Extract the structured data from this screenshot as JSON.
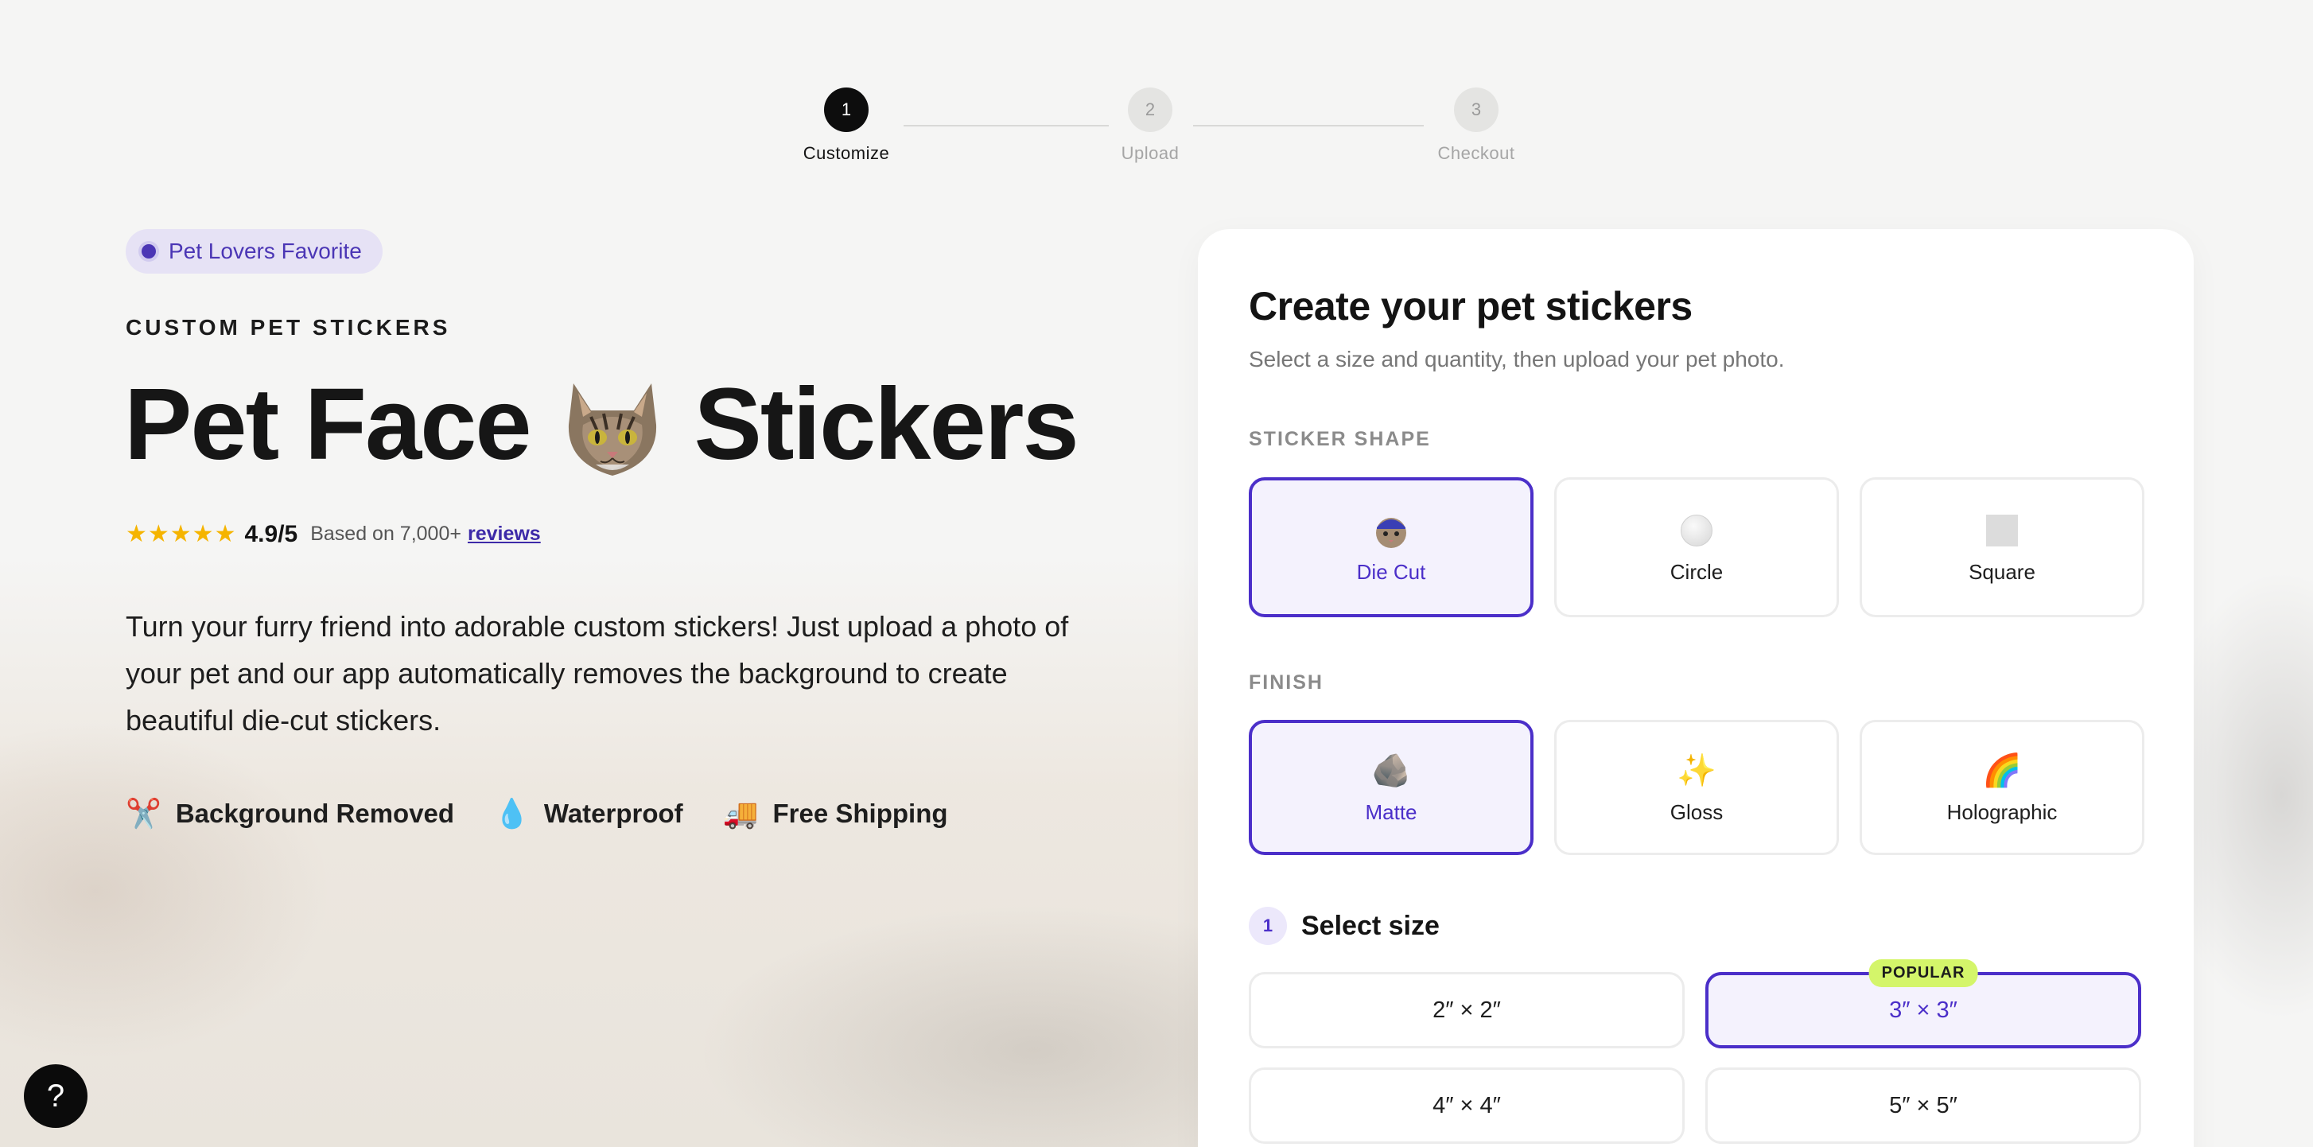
{
  "stepper": {
    "steps": [
      {
        "number": "1",
        "label": "Customize",
        "active": true
      },
      {
        "number": "2",
        "label": "Upload",
        "active": false
      },
      {
        "number": "3",
        "label": "Checkout",
        "active": false
      }
    ]
  },
  "hero": {
    "badge": "Pet Lovers Favorite",
    "eyebrow": "CUSTOM PET STICKERS",
    "title_part1": "Pet Face",
    "title_part2": "Stickers",
    "title_image": "cat-face-sticker",
    "rating": {
      "stars": "★★★★★",
      "value": "4.9/5",
      "text": "Based on 7,000+",
      "link": "reviews"
    },
    "description": "Turn your furry friend into adorable custom stickers! Just upload a photo of your pet and our app automatically removes the background to create beautiful die-cut stickers.",
    "features": [
      {
        "icon": "✂️",
        "icon_name": "scissors-icon",
        "label": "Background Removed"
      },
      {
        "icon": "💧",
        "icon_name": "droplet-icon",
        "label": "Waterproof"
      },
      {
        "icon": "🚚",
        "icon_name": "truck-icon",
        "label": "Free Shipping"
      }
    ]
  },
  "help": {
    "label": "?"
  },
  "card": {
    "title": "Create your pet stickers",
    "subtitle": "Select a size and quantity, then upload your pet photo.",
    "shape": {
      "label": "STICKER SHAPE",
      "options": [
        {
          "label": "Die Cut",
          "icon": "die-cut-icon",
          "selected": true
        },
        {
          "label": "Circle",
          "icon": "circle-icon",
          "selected": false
        },
        {
          "label": "Square",
          "icon": "square-icon",
          "selected": false
        }
      ]
    },
    "finish": {
      "label": "FINISH",
      "options": [
        {
          "label": "Matte",
          "icon": "🪨",
          "icon_name": "rock-icon",
          "selected": true
        },
        {
          "label": "Gloss",
          "icon": "✨",
          "icon_name": "sparkles-icon",
          "selected": false
        },
        {
          "label": "Holographic",
          "icon": "🌈",
          "icon_name": "rainbow-icon",
          "selected": false
        }
      ]
    },
    "size": {
      "step_number": "1",
      "title": "Select size",
      "options": [
        {
          "label": "2″ × 2″",
          "selected": false,
          "badge": ""
        },
        {
          "label": "3″ × 3″",
          "selected": true,
          "badge": "POPULAR"
        },
        {
          "label": "4″ × 4″",
          "selected": false,
          "badge": ""
        },
        {
          "label": "5″ × 5″",
          "selected": false,
          "badge": ""
        }
      ]
    }
  },
  "colors": {
    "accent": "#4b2fc9",
    "badge_bg": "#e6e2f5",
    "popular_badge": "#d4f56a",
    "star": "#f5b400"
  }
}
